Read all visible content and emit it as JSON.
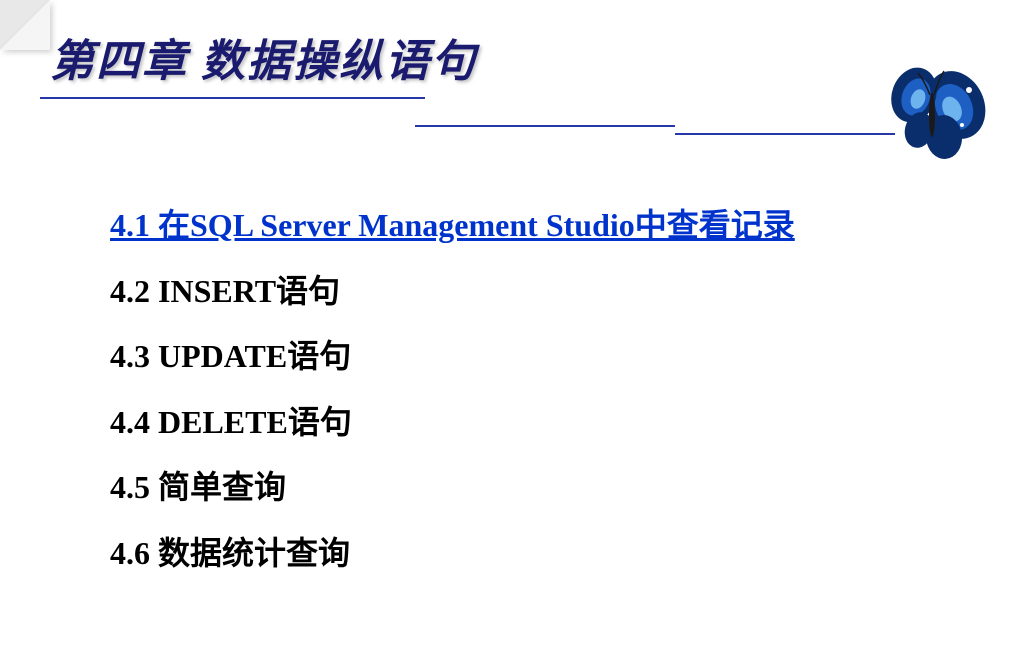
{
  "header": {
    "title": "第四章 数据操纵语句"
  },
  "toc": {
    "items": [
      {
        "label": "4.1 在SQL Server Management Studio中查看记录",
        "active": true
      },
      {
        "label": "4.2 INSERT语句",
        "active": false
      },
      {
        "label": "4.3 UPDATE语句",
        "active": false
      },
      {
        "label": "4.4 DELETE语句",
        "active": false
      },
      {
        "label": "4.5 简单查询",
        "active": false
      },
      {
        "label": "4.6 数据统计查询",
        "active": false
      }
    ]
  },
  "decoration": {
    "butterfly": "butterfly-icon"
  }
}
